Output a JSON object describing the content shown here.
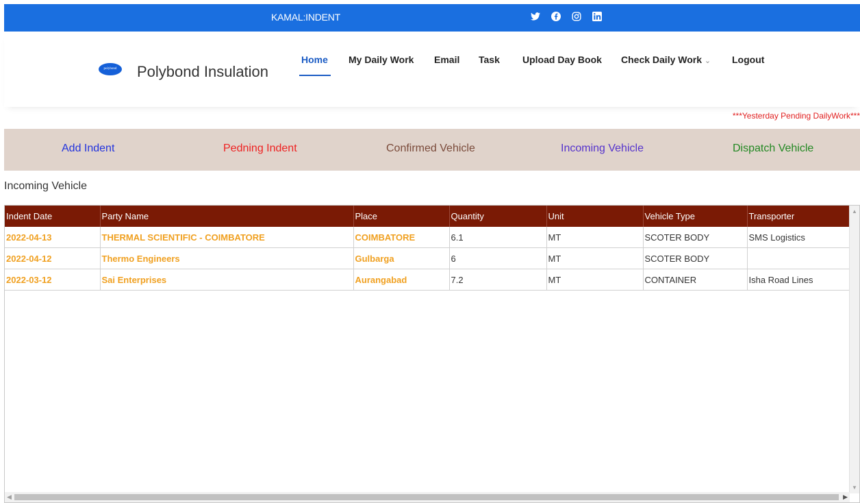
{
  "topbar": {
    "user": "KAMAL:INDENT",
    "social": [
      "twitter-icon",
      "facebook-icon",
      "instagram-icon",
      "linkedin-icon"
    ]
  },
  "brand": {
    "logo_text": "polybond",
    "name": "Polybond Insulation"
  },
  "nav": {
    "home": "Home",
    "daily_work": "My Daily Work",
    "email": "Email",
    "task": "Task",
    "upload": "Upload Day Book",
    "check": "Check Daily Work",
    "logout": "Logout"
  },
  "pending_notice": "***Yesterday Pending DailyWork***",
  "tabs": {
    "add": "Add Indent",
    "pending": "Pedning Indent",
    "confirmed": "Confirmed Vehicle",
    "incoming": "Incoming Vehicle",
    "dispatch": "Dispatch Vehicle"
  },
  "section_title": "Incoming Vehicle",
  "table": {
    "headers": [
      "Indent Date",
      "Party Name",
      "Place",
      "Quantity",
      "Unit",
      "Vehicle Type",
      "Transporter"
    ],
    "rows": [
      [
        "2022-04-13",
        "THERMAL SCIENTIFIC - COIMBATORE",
        "COIMBATORE",
        "6.1",
        "MT",
        "SCOTER BODY",
        "SMS Logistics"
      ],
      [
        "2022-04-12",
        "Thermo Engineers",
        "Gulbarga",
        "6",
        "MT",
        "SCOTER BODY",
        ""
      ],
      [
        "2022-03-12",
        "Sai Enterprises",
        "Aurangabad",
        "7.2",
        "MT",
        "CONTAINER",
        "Isha Road Lines"
      ]
    ]
  },
  "colors": {
    "topbar": "#1a6fe0",
    "table_header": "#7a1a05",
    "highlight": "#f0a020",
    "tab_add": "#2233dd",
    "tab_pending": "#ee2222",
    "tab_confirmed": "#7a4a3a",
    "tab_incoming": "#5533cc",
    "tab_dispatch": "#228822"
  }
}
